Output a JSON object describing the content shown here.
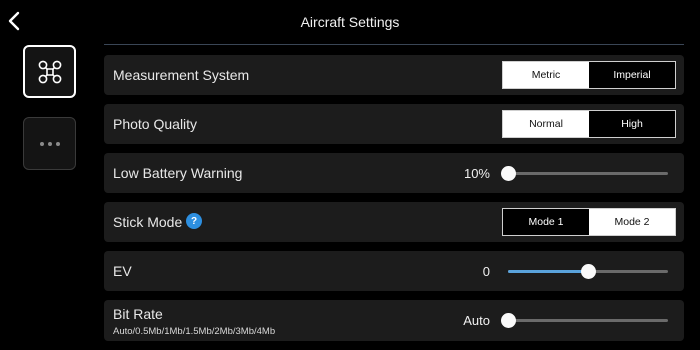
{
  "header": {
    "title": "Aircraft Settings",
    "back_icon": "chevron-left-icon"
  },
  "sidebar": {
    "items": [
      {
        "icon": "drone-icon",
        "active": true
      },
      {
        "icon": "more-icon",
        "active": false
      }
    ]
  },
  "settings": {
    "measurement": {
      "label": "Measurement System",
      "options": [
        "Metric",
        "Imperial"
      ],
      "selected": "Metric"
    },
    "photo_quality": {
      "label": "Photo Quality",
      "options": [
        "Normal",
        "High"
      ],
      "selected": "Normal"
    },
    "low_battery": {
      "label": "Low Battery Warning",
      "value": "10%",
      "level": 0
    },
    "stick_mode": {
      "label": "Stick Mode",
      "help": "?",
      "options": [
        "Mode 1",
        "Mode 2"
      ],
      "selected": "Mode 2"
    },
    "ev": {
      "label": "EV",
      "value": "0",
      "level": 0.5
    },
    "bit_rate": {
      "label": "Bit Rate",
      "sub": "Auto/0.5Mb/1Mb/1.5Mb/2Mb/3Mb/4Mb",
      "value": "Auto",
      "level": 0
    }
  },
  "colors": {
    "accent": "#2d8fe0",
    "slider_fill": "#5aa3dc",
    "row_bg": "#1c1c1c"
  }
}
